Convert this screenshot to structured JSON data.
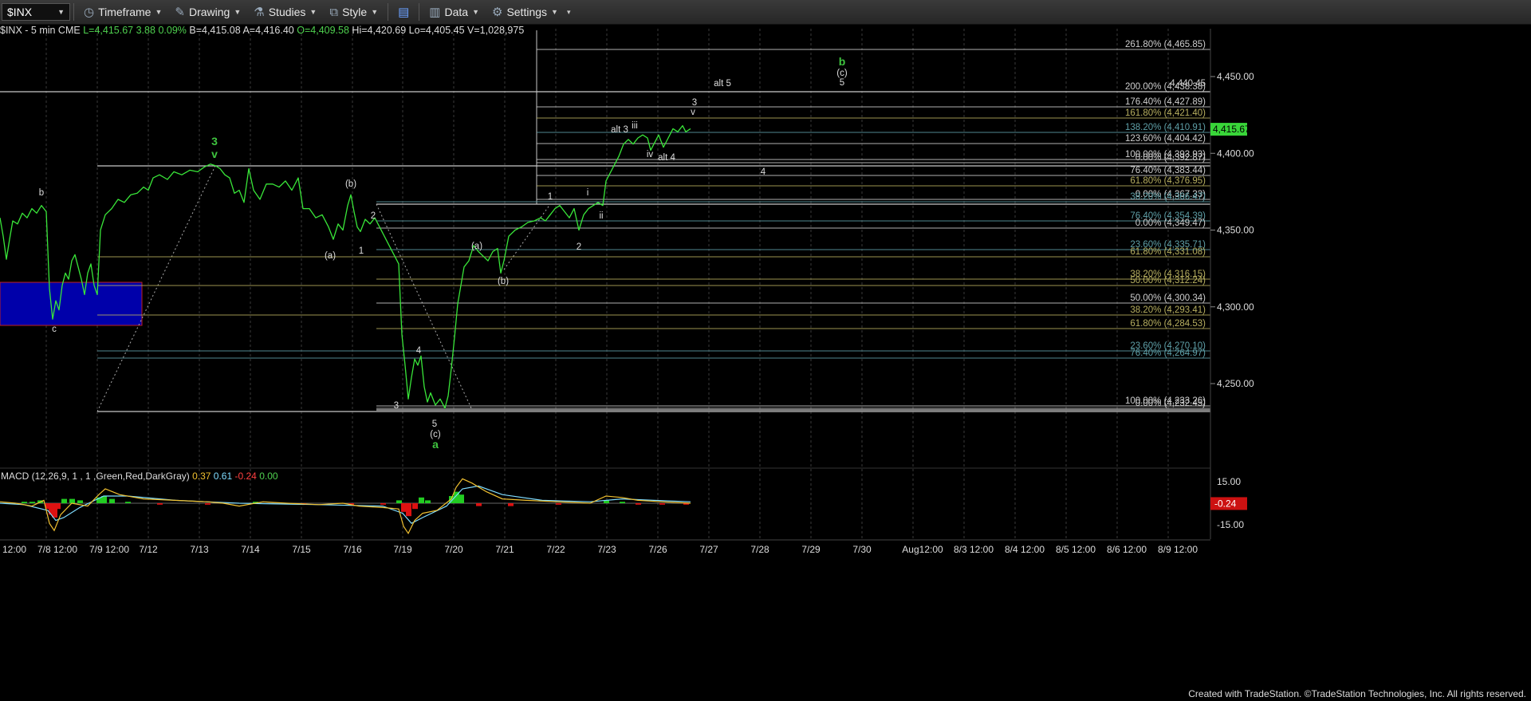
{
  "toolbar": {
    "symbol": "$INX",
    "timeframe": "Timeframe",
    "drawing": "Drawing",
    "studies": "Studies",
    "style": "Style",
    "data": "Data",
    "settings": "Settings"
  },
  "infobar": {
    "symbol": "$INX - 5 min  CME",
    "last": "L=4,415.67",
    "change": "3.88",
    "change_pct": "0.09%",
    "bid": "B=4,415.08",
    "ask": "A=4,416.40",
    "open": "O=4,409.58",
    "high": "Hi=4,420.69",
    "low": "Lo=4,405.45",
    "volume": "V=1,028,975"
  },
  "footer": "Created with TradeStation. ©TradeStation Technologies, Inc. All rights reserved.",
  "colors": {
    "price_line": "#39e639",
    "macd_line": "#f0c030",
    "signal_line": "#7fdcff",
    "hist_pos": "#22cc22",
    "hist_neg": "#dd1111",
    "box_fill": "#0000aa",
    "wave_green": "#3fc43f"
  },
  "chart_data": {
    "type": "line",
    "price_axis": {
      "ticks": [
        "4,450.00",
        "4,400.00",
        "4,350.00",
        "4,300.00",
        "4,250.00"
      ],
      "values": [
        4450,
        4400,
        4350,
        4300,
        4250
      ],
      "ylim": [
        4211,
        4470
      ]
    },
    "last_price": "4,415.67",
    "x_labels": [
      "12:00",
      "7/8 12:00",
      "7/9 12:00",
      "7/12",
      "7/13",
      "7/14",
      "7/15",
      "7/16",
      "7/19",
      "7/20",
      "7/21",
      "7/22",
      "7/23",
      "7/26",
      "7/27",
      "7/28",
      "7/29",
      "7/30",
      "Aug12:00",
      "8/3 12:00",
      "8/4 12:00",
      "8/5 12:00",
      "8/6 12:00",
      "8/9 12:00"
    ],
    "price_series": [
      [
        0,
        4358
      ],
      [
        4,
        4346
      ],
      [
        8,
        4331
      ],
      [
        12,
        4344
      ],
      [
        16,
        4356
      ],
      [
        22,
        4354
      ],
      [
        28,
        4361
      ],
      [
        34,
        4358
      ],
      [
        40,
        4364
      ],
      [
        46,
        4361
      ],
      [
        52,
        4366
      ],
      [
        58,
        4362
      ],
      [
        62,
        4312
      ],
      [
        66,
        4292
      ],
      [
        70,
        4304
      ],
      [
        74,
        4298
      ],
      [
        78,
        4314
      ],
      [
        82,
        4322
      ],
      [
        86,
        4318
      ],
      [
        90,
        4330
      ],
      [
        94,
        4334
      ],
      [
        98,
        4326
      ],
      [
        102,
        4318
      ],
      [
        106,
        4308
      ],
      [
        110,
        4322
      ],
      [
        114,
        4328
      ],
      [
        118,
        4314
      ],
      [
        122,
        4308
      ],
      [
        126,
        4350
      ],
      [
        132,
        4360
      ],
      [
        140,
        4364
      ],
      [
        148,
        4370
      ],
      [
        156,
        4368
      ],
      [
        164,
        4373
      ],
      [
        172,
        4374
      ],
      [
        180,
        4378
      ],
      [
        186,
        4376
      ],
      [
        192,
        4384
      ],
      [
        200,
        4386
      ],
      [
        210,
        4383
      ],
      [
        218,
        4388
      ],
      [
        228,
        4386
      ],
      [
        238,
        4389
      ],
      [
        248,
        4388
      ],
      [
        256,
        4391
      ],
      [
        264,
        4393
      ],
      [
        270,
        4392
      ],
      [
        276,
        4390
      ],
      [
        282,
        4386
      ],
      [
        288,
        4384
      ],
      [
        294,
        4374
      ],
      [
        300,
        4376
      ],
      [
        306,
        4368
      ],
      [
        312,
        4390
      ],
      [
        318,
        4376
      ],
      [
        326,
        4370
      ],
      [
        334,
        4380
      ],
      [
        342,
        4380
      ],
      [
        350,
        4378
      ],
      [
        358,
        4382
      ],
      [
        366,
        4376
      ],
      [
        374,
        4384
      ],
      [
        380,
        4364
      ],
      [
        388,
        4364
      ],
      [
        396,
        4358
      ],
      [
        404,
        4360
      ],
      [
        412,
        4352
      ],
      [
        418,
        4344
      ],
      [
        424,
        4354
      ],
      [
        430,
        4350
      ],
      [
        436,
        4366
      ],
      [
        440,
        4373
      ],
      [
        444,
        4362
      ],
      [
        448,
        4352
      ],
      [
        452,
        4349
      ],
      [
        458,
        4357
      ],
      [
        464,
        4354
      ],
      [
        470,
        4358
      ],
      [
        476,
        4352
      ],
      [
        482,
        4346
      ],
      [
        488,
        4340
      ],
      [
        494,
        4334
      ],
      [
        500,
        4328
      ],
      [
        504,
        4282
      ],
      [
        508,
        4262
      ],
      [
        512,
        4240
      ],
      [
        516,
        4254
      ],
      [
        520,
        4266
      ],
      [
        524,
        4262
      ],
      [
        528,
        4268
      ],
      [
        532,
        4248
      ],
      [
        536,
        4238
      ],
      [
        540,
        4244
      ],
      [
        546,
        4236
      ],
      [
        552,
        4240
      ],
      [
        558,
        4234
      ],
      [
        562,
        4242
      ],
      [
        566,
        4260
      ],
      [
        570,
        4280
      ],
      [
        574,
        4302
      ],
      [
        578,
        4314
      ],
      [
        582,
        4326
      ],
      [
        588,
        4330
      ],
      [
        594,
        4340
      ],
      [
        600,
        4336
      ],
      [
        606,
        4333
      ],
      [
        612,
        4330
      ],
      [
        618,
        4336
      ],
      [
        624,
        4338
      ],
      [
        628,
        4322
      ],
      [
        632,
        4330
      ],
      [
        638,
        4346
      ],
      [
        646,
        4350
      ],
      [
        654,
        4352
      ],
      [
        662,
        4355
      ],
      [
        670,
        4356
      ],
      [
        678,
        4358
      ],
      [
        684,
        4356
      ],
      [
        690,
        4360
      ],
      [
        696,
        4364
      ],
      [
        702,
        4366
      ],
      [
        708,
        4362
      ],
      [
        714,
        4358
      ],
      [
        720,
        4364
      ],
      [
        726,
        4350
      ],
      [
        732,
        4360
      ],
      [
        738,
        4364
      ],
      [
        744,
        4366
      ],
      [
        750,
        4368
      ],
      [
        756,
        4366
      ],
      [
        760,
        4382
      ],
      [
        764,
        4386
      ],
      [
        770,
        4392
      ],
      [
        776,
        4398
      ],
      [
        782,
        4406
      ],
      [
        788,
        4409
      ],
      [
        794,
        4406
      ],
      [
        800,
        4410
      ],
      [
        806,
        4412
      ],
      [
        812,
        4410
      ],
      [
        816,
        4402
      ],
      [
        820,
        4406
      ],
      [
        826,
        4412
      ],
      [
        832,
        4404
      ],
      [
        838,
        4410
      ],
      [
        844,
        4416
      ],
      [
        850,
        4414
      ],
      [
        856,
        4418
      ],
      [
        860,
        4414
      ],
      [
        866,
        4416
      ]
    ],
    "wave_labels": [
      {
        "text": "b",
        "x": 52,
        "y": 245,
        "color": "#ddd"
      },
      {
        "text": "c",
        "x": 68,
        "y": 416,
        "color": "#ddd"
      },
      {
        "text": "3",
        "x": 269,
        "y": 182,
        "color": "#3fc43f"
      },
      {
        "text": "v",
        "x": 269,
        "y": 198,
        "color": "#3fc43f"
      },
      {
        "text": "(b)",
        "x": 440,
        "y": 234,
        "color": "#ddd"
      },
      {
        "text": "(a)",
        "x": 414,
        "y": 324,
        "color": "#ddd"
      },
      {
        "text": "1",
        "x": 453,
        "y": 318,
        "color": "#ddd"
      },
      {
        "text": "2",
        "x": 468,
        "y": 274,
        "color": "#ddd"
      },
      {
        "text": "4",
        "x": 525,
        "y": 443,
        "color": "#ddd"
      },
      {
        "text": "3",
        "x": 497,
        "y": 512,
        "color": "#ddd"
      },
      {
        "text": "5",
        "x": 545,
        "y": 535,
        "color": "#ddd"
      },
      {
        "text": "(c)",
        "x": 546,
        "y": 548,
        "color": "#ddd"
      },
      {
        "text": "a",
        "x": 546,
        "y": 562,
        "color": "#3fc43f"
      },
      {
        "text": "(a)",
        "x": 598,
        "y": 312,
        "color": "#ddd"
      },
      {
        "text": "(b)",
        "x": 631,
        "y": 356,
        "color": "#ddd"
      },
      {
        "text": "1",
        "x": 690,
        "y": 250,
        "color": "#ddd"
      },
      {
        "text": "2",
        "x": 726,
        "y": 313,
        "color": "#ddd"
      },
      {
        "text": "i",
        "x": 737,
        "y": 245,
        "color": "#ddd"
      },
      {
        "text": "ii",
        "x": 754,
        "y": 274,
        "color": "#ddd"
      },
      {
        "text": "alt 3",
        "x": 777,
        "y": 166,
        "color": "#ddd"
      },
      {
        "text": "iii",
        "x": 796,
        "y": 161,
        "color": "#ddd"
      },
      {
        "text": "iv",
        "x": 815,
        "y": 197,
        "color": "#ddd"
      },
      {
        "text": "alt 4",
        "x": 836,
        "y": 201,
        "color": "#ddd"
      },
      {
        "text": "3",
        "x": 871,
        "y": 132,
        "color": "#ddd"
      },
      {
        "text": "v",
        "x": 869,
        "y": 144,
        "color": "#ddd"
      },
      {
        "text": "alt 5",
        "x": 906,
        "y": 108,
        "color": "#ddd"
      },
      {
        "text": "4",
        "x": 957,
        "y": 219,
        "color": "#ddd"
      },
      {
        "text": "b",
        "x": 1056,
        "y": 82,
        "color": "#3fc43f"
      },
      {
        "text": "(c)",
        "x": 1056,
        "y": 95,
        "color": "#ddd"
      },
      {
        "text": "5",
        "x": 1056,
        "y": 107,
        "color": "#ddd"
      }
    ],
    "fib_labels": [
      {
        "text": "261.80% (4,465.85)",
        "color": "#cfcfcf"
      },
      {
        "text": "4,440.45",
        "color": "#cfcfcf"
      },
      {
        "text": "200.00% (4,438.38)",
        "color": "#cfcfcf"
      },
      {
        "text": "176.40% (4,427.89)",
        "color": "#cfcfcf"
      },
      {
        "text": "161.80% (4,421.40)",
        "color": "#b8b060"
      },
      {
        "text": "138.20% (4,410.91)",
        "color": "#5fa0a8"
      },
      {
        "text": "123.60% (4,404.42)",
        "color": "#cfcfcf"
      },
      {
        "text": "100.00% (4,393.93)",
        "color": "#cfcfcf"
      },
      {
        "text": "0.00% (4,392.87)",
        "color": "#cfcfcf"
      },
      {
        "text": "76.40% (4,383.44)",
        "color": "#cfcfcf"
      },
      {
        "text": "61.80% (4,376.95)",
        "color": "#b8b060"
      },
      {
        "text": "0.00% (4,367.33)",
        "color": "#cfcfcf"
      },
      {
        "text": "38.20% (4,366.47)",
        "color": "#5fa0a8"
      },
      {
        "text": "76.40% (4,354.39)",
        "color": "#5fa0a8"
      },
      {
        "text": "0.00% (4,349.47)",
        "color": "#cfcfcf"
      },
      {
        "text": "23.60% (4,335.71)",
        "color": "#5fa0a8"
      },
      {
        "text": "61.80% (4,331.08)",
        "color": "#b8b060"
      },
      {
        "text": "38.20% (4,316.15)",
        "color": "#b8b060"
      },
      {
        "text": "50.00% (4,312.24)",
        "color": "#b8b060"
      },
      {
        "text": "50.00% (4,300.34)",
        "color": "#cfcfcf"
      },
      {
        "text": "38.20% (4,293.41)",
        "color": "#b8b060"
      },
      {
        "text": "61.80% (4,284.53)",
        "color": "#b8b060"
      },
      {
        "text": "23.60% (4,270.10)",
        "color": "#5fa0a8"
      },
      {
        "text": "76.40% (4,264.97)",
        "color": "#5fa0a8"
      },
      {
        "text": "100.00% (4,233.26)",
        "color": "#cfcfcf"
      },
      {
        "text": "0.00% (4,232.45)",
        "color": "#cfcfcf"
      }
    ],
    "macd": {
      "label": "MACD (12,26,9, 1 , 1 ,Green,Red,DarkGray)",
      "macd_value": "0.37",
      "signal_value": "0.61",
      "hist_value": "-0.24",
      "zero_value": "0.00",
      "axis_ticks": [
        "15.00",
        "-15.00"
      ],
      "axis_values": [
        15,
        -15
      ],
      "ylim": [
        -22,
        22
      ],
      "last_value": "-0.24",
      "macd_series": [
        [
          0,
          1
        ],
        [
          20,
          0
        ],
        [
          40,
          -2
        ],
        [
          55,
          2
        ],
        [
          62,
          -14
        ],
        [
          68,
          -19
        ],
        [
          76,
          -8
        ],
        [
          90,
          0
        ],
        [
          110,
          -2
        ],
        [
          124,
          6
        ],
        [
          132,
          10
        ],
        [
          150,
          6
        ],
        [
          180,
          3
        ],
        [
          220,
          2
        ],
        [
          260,
          1
        ],
        [
          280,
          0
        ],
        [
          300,
          -2
        ],
        [
          330,
          1
        ],
        [
          360,
          0
        ],
        [
          400,
          -1
        ],
        [
          430,
          0
        ],
        [
          450,
          -2
        ],
        [
          480,
          -3
        ],
        [
          500,
          -4
        ],
        [
          506,
          -16
        ],
        [
          512,
          -21
        ],
        [
          520,
          -12
        ],
        [
          530,
          -7
        ],
        [
          548,
          -5
        ],
        [
          566,
          3
        ],
        [
          572,
          11
        ],
        [
          580,
          17
        ],
        [
          592,
          14
        ],
        [
          610,
          8
        ],
        [
          630,
          3
        ],
        [
          660,
          2
        ],
        [
          700,
          1
        ],
        [
          740,
          0
        ],
        [
          760,
          5
        ],
        [
          780,
          4
        ],
        [
          800,
          2
        ],
        [
          830,
          1
        ],
        [
          866,
          0
        ]
      ],
      "signal_series": [
        [
          0,
          0
        ],
        [
          30,
          -1
        ],
        [
          60,
          -5
        ],
        [
          70,
          -12
        ],
        [
          80,
          -10
        ],
        [
          100,
          -3
        ],
        [
          130,
          5
        ],
        [
          160,
          5
        ],
        [
          220,
          2
        ],
        [
          300,
          0
        ],
        [
          400,
          -1
        ],
        [
          480,
          -2
        ],
        [
          505,
          -7
        ],
        [
          516,
          -14
        ],
        [
          530,
          -10
        ],
        [
          560,
          -2
        ],
        [
          580,
          10
        ],
        [
          600,
          12
        ],
        [
          630,
          6
        ],
        [
          680,
          2
        ],
        [
          740,
          1
        ],
        [
          780,
          3
        ],
        [
          820,
          2
        ],
        [
          866,
          1
        ]
      ],
      "histogram": [
        [
          30,
          1
        ],
        [
          40,
          1
        ],
        [
          50,
          2
        ],
        [
          60,
          -4
        ],
        [
          64,
          -8
        ],
        [
          68,
          -10
        ],
        [
          72,
          -4
        ],
        [
          80,
          3
        ],
        [
          90,
          3
        ],
        [
          100,
          2
        ],
        [
          124,
          4
        ],
        [
          130,
          5
        ],
        [
          140,
          3
        ],
        [
          160,
          1
        ],
        [
          200,
          -1
        ],
        [
          260,
          -1
        ],
        [
          320,
          1
        ],
        [
          380,
          -1
        ],
        [
          440,
          -1
        ],
        [
          480,
          -1
        ],
        [
          500,
          2
        ],
        [
          506,
          -6
        ],
        [
          512,
          -9
        ],
        [
          520,
          -4
        ],
        [
          528,
          4
        ],
        [
          536,
          2
        ],
        [
          566,
          5
        ],
        [
          572,
          8
        ],
        [
          578,
          6
        ],
        [
          600,
          -2
        ],
        [
          640,
          -2
        ],
        [
          700,
          -1
        ],
        [
          760,
          2
        ],
        [
          780,
          1
        ],
        [
          800,
          -1
        ],
        [
          830,
          -1
        ],
        [
          860,
          -1
        ]
      ]
    }
  }
}
